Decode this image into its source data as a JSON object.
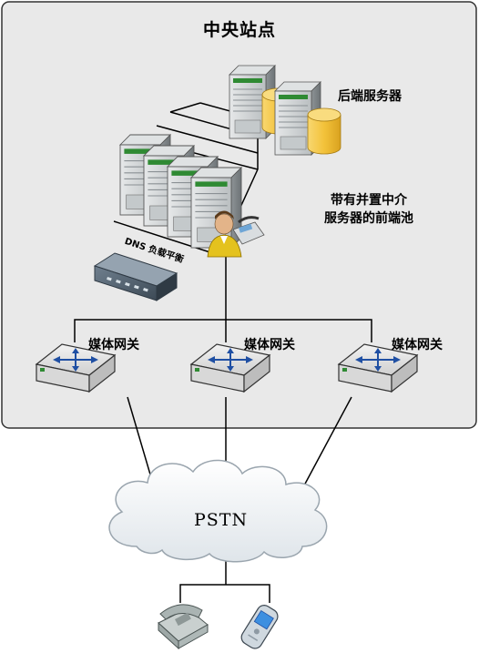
{
  "central_site": {
    "title": "中央站点"
  },
  "backend": {
    "label": "后端服务器"
  },
  "frontend_pool": {
    "label_line1": "带有并置中介",
    "label_line2": "服务器的前端池"
  },
  "load_balancer": {
    "label": "DNS 负载平衡"
  },
  "gateways": [
    {
      "label": "媒体网关"
    },
    {
      "label": "媒体网关"
    },
    {
      "label": "媒体网关"
    }
  ],
  "pstn": {
    "label": "PSTN"
  },
  "icons": {
    "backend_servers": "server-icon",
    "databases": "database-icon",
    "frontend_servers": "server-icon",
    "user": "user-icon",
    "desk_phone": "desk-phone-icon",
    "hardware_load_balancer": "load-balancer-appliance-icon",
    "gateway": "media-gateway-icon",
    "cloud": "cloud-icon",
    "endpoint_phone": "telephone-icon",
    "mobile_phone": "mobile-phone-icon"
  },
  "colors": {
    "site_fill": "#e9e9e9",
    "site_border": "#333333",
    "server_body": "#cfd3d4",
    "server_accent": "#2f8a33",
    "database": "#f3c23a",
    "gateway_arrows": "#1f4fa3",
    "line": "#000000"
  }
}
